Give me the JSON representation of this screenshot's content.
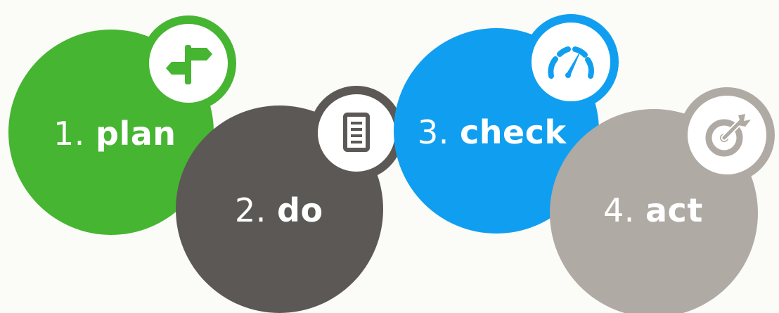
{
  "steps": [
    {
      "number": "1.",
      "word": "plan",
      "icon": "signpost-icon",
      "color": "#46b531"
    },
    {
      "number": "2.",
      "word": "do",
      "icon": "document-icon",
      "color": "#5c5855"
    },
    {
      "number": "3.",
      "word": "check",
      "icon": "gauge-icon",
      "color": "#109ff0"
    },
    {
      "number": "4.",
      "word": "act",
      "icon": "target-icon",
      "color": "#b0aaa4"
    }
  ]
}
